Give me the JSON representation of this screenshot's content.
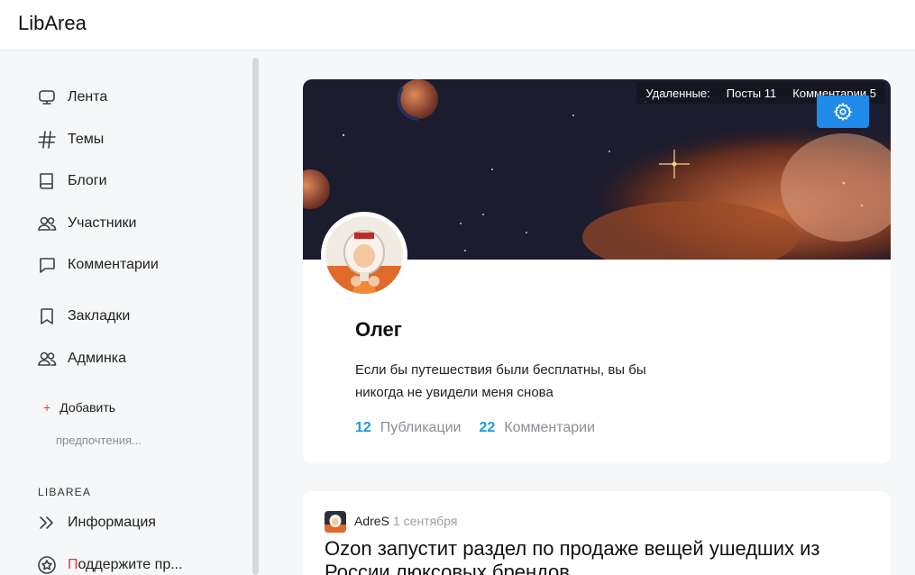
{
  "app": {
    "logo": "LibArea"
  },
  "sidebar": {
    "items": [
      {
        "label": "Лента",
        "icon": "monitor-icon"
      },
      {
        "label": "Темы",
        "icon": "hash-icon"
      },
      {
        "label": "Блоги",
        "icon": "book-icon"
      },
      {
        "label": "Участники",
        "icon": "users-icon"
      },
      {
        "label": "Комментарии",
        "icon": "comment-icon"
      },
      {
        "label": "Закладки",
        "icon": "bookmark-icon"
      },
      {
        "label": "Админка",
        "icon": "users-icon"
      }
    ],
    "add_label": "Добавить",
    "add_icon": "plus-icon",
    "preferences_label": "предпочтения...",
    "section_title": "LIBAREA",
    "info_label": "Информация",
    "support_first_letter": "П",
    "support_rest": "оддержите пр..."
  },
  "profile": {
    "deleted_label": "Удаленные:",
    "deleted_posts": "Посты 11",
    "deleted_comments": "Комментарии 5",
    "name": "Олег",
    "bio": "Если бы путешествия были бесплатны, вы бы никогда не увидели меня снова",
    "publications_count": "12",
    "publications_label": "Публикации",
    "comments_count": "22",
    "comments_label": "Комментарии",
    "accent_color": "#1f8ae8"
  },
  "post": {
    "author": "AdreS",
    "date": "1 сентября",
    "title": "Ozon запустит раздел по продаже вещей ушедших из России люксовых брендов"
  }
}
